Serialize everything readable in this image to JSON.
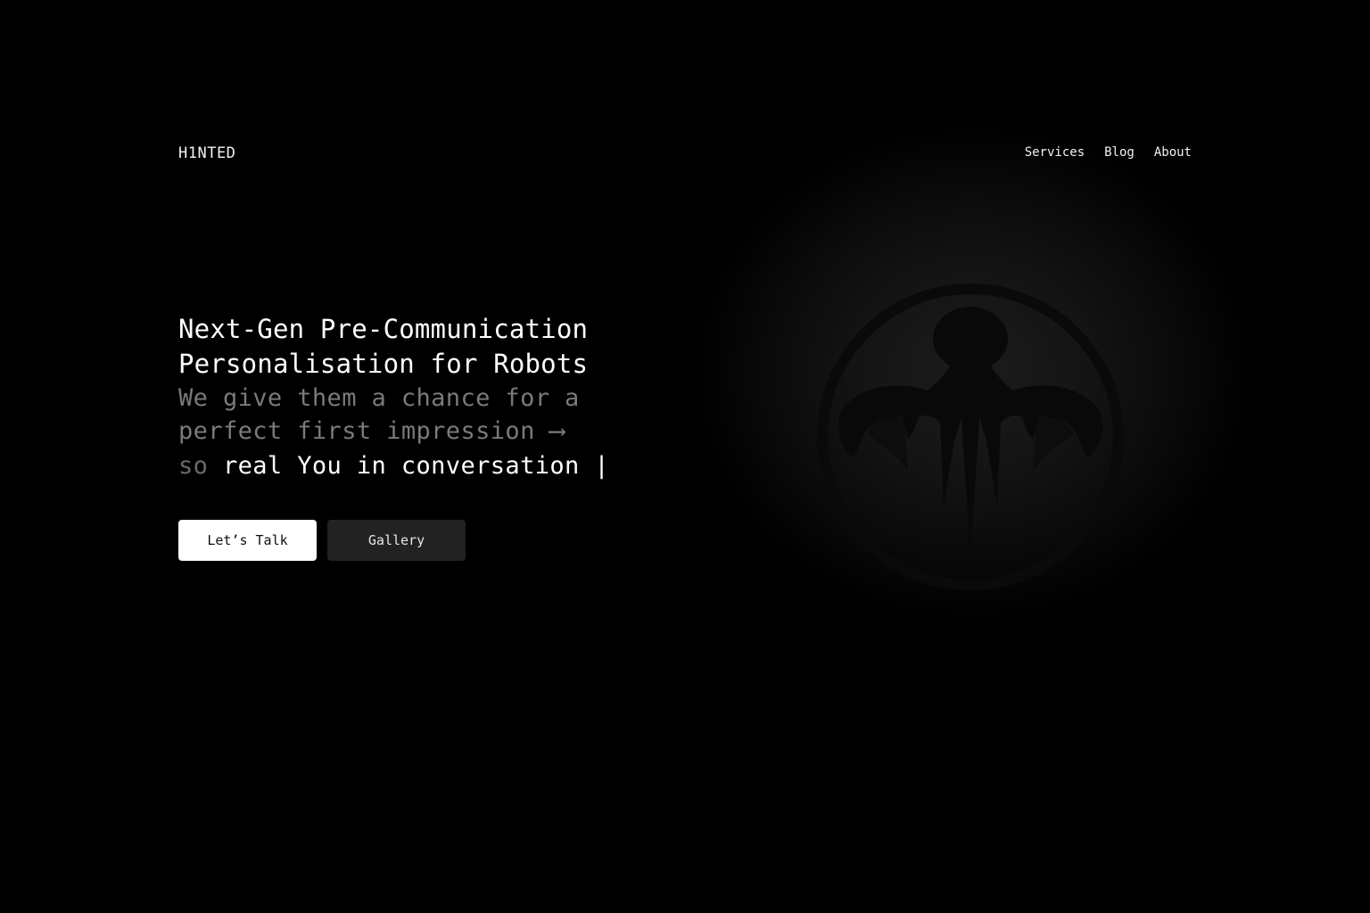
{
  "header": {
    "logo": "H1NTED",
    "nav": [
      {
        "label": "Services"
      },
      {
        "label": "Blog"
      },
      {
        "label": "About"
      }
    ]
  },
  "hero": {
    "title_line1": "Next-Gen Pre-Communication",
    "title_line2": "Personalisation for Robots",
    "subtitle_line1": "We give them a chance for a",
    "subtitle_line2": "perfect first impression ⟶",
    "typing_prefix": "so ",
    "typing_text": "real You in conversation",
    "typing_cursor": "|"
  },
  "buttons": {
    "primary_label": "Let’s Talk",
    "secondary_label": "Gallery"
  },
  "colors": {
    "background": "#000000",
    "text_primary": "#ffffff",
    "text_muted": "#7a7a7a",
    "button_primary_bg": "#ffffff",
    "button_secondary_bg": "#222222"
  },
  "icons": {
    "emblem": "octopus-emblem-icon"
  }
}
